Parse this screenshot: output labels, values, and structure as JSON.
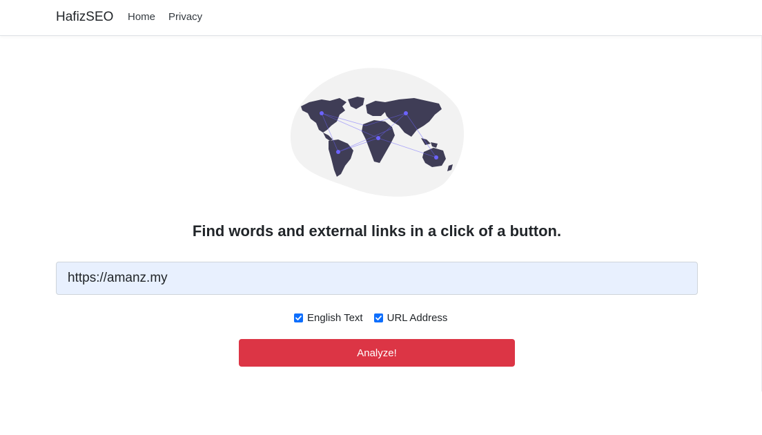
{
  "navbar": {
    "brand": "HafizSEO",
    "links": [
      {
        "label": "Home"
      },
      {
        "label": "Privacy"
      }
    ]
  },
  "hero": {
    "illustration": "world-map-network-icon",
    "blob_color": "#f2f2f2",
    "map_color": "#3f3d56",
    "node_color": "#6c63ff"
  },
  "main": {
    "headline": "Find words and external links in a click of a button.",
    "url_input": {
      "value": "https://amanz.my",
      "background": "#e8f0fe"
    },
    "options": [
      {
        "label": "English Text",
        "checked": true
      },
      {
        "label": "URL Address",
        "checked": true
      }
    ],
    "analyze_button": {
      "label": "Analyze!",
      "color": "#dc3545"
    }
  }
}
